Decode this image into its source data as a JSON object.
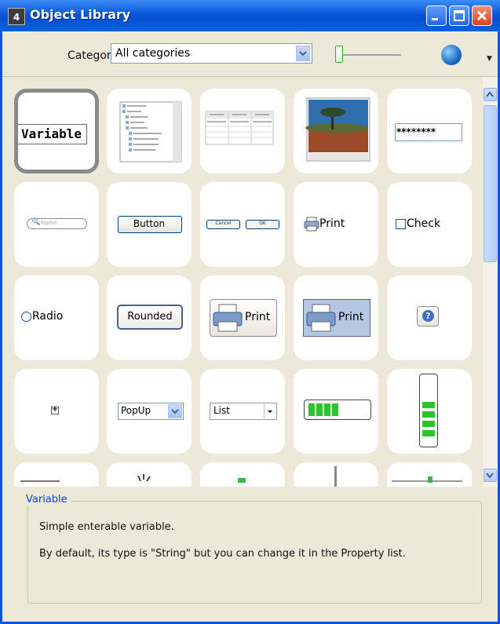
{
  "window": {
    "title": "Object Library",
    "app_icon": "4"
  },
  "toolbar": {
    "category_label": "Category:",
    "category_value": "All categories"
  },
  "tiles": {
    "variable": "Variable",
    "password": "********",
    "search_placeholder": "Name",
    "button": "Button",
    "cancel": "Cancel",
    "ok": "OK",
    "print": "Print",
    "check": "Check",
    "radio": "Radio",
    "rounded": "Rounded",
    "help": "?",
    "popup": "PopUp",
    "list": "List",
    "plus": "+"
  },
  "description": {
    "heading": "Variable",
    "line1": "Simple enterable variable.",
    "line2": "By default, its type is \"String\" but you can change it in the Property list."
  }
}
